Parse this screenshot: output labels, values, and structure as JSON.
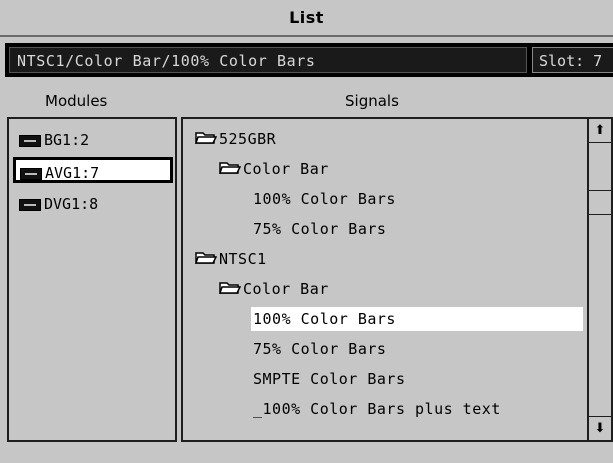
{
  "window": {
    "title": "List"
  },
  "path_bar": {
    "path": "NTSC1/Color Bar/100% Color  Bars",
    "slot": "Slot: 7"
  },
  "headers": {
    "modules": "Modules",
    "signals": "Signals"
  },
  "modules": [
    {
      "label": "BG1:2",
      "selected": false
    },
    {
      "label": "AVG1:7",
      "selected": true
    },
    {
      "label": "DVG1:8",
      "selected": false
    }
  ],
  "signals": [
    {
      "label": "525GBR",
      "folder": true,
      "level": 0,
      "selected": false
    },
    {
      "label": "Color Bar",
      "folder": true,
      "level": 1,
      "selected": false
    },
    {
      "label": "100%  Color Bars",
      "folder": false,
      "level": 2,
      "selected": false
    },
    {
      "label": "75%  Color Bars",
      "folder": false,
      "level": 2,
      "selected": false
    },
    {
      "label": "NTSC1",
      "folder": true,
      "level": 0,
      "selected": false
    },
    {
      "label": "Color Bar",
      "folder": true,
      "level": 1,
      "selected": false
    },
    {
      "label": "100% Color  Bars",
      "folder": false,
      "level": 2,
      "selected": true
    },
    {
      "label": "75% Color  Bars",
      "folder": false,
      "level": 2,
      "selected": false
    },
    {
      "label": "SMPTE Color  Bars",
      "folder": false,
      "level": 2,
      "selected": false
    },
    {
      "label": "_100% Color  Bars plus  text",
      "folder": false,
      "level": 2,
      "selected": false
    }
  ],
  "scrollbar": {
    "up_icon": "arrow-up-icon",
    "down_icon": "arrow-down-icon",
    "up_glyph": "⬆",
    "down_glyph": "⬇"
  }
}
